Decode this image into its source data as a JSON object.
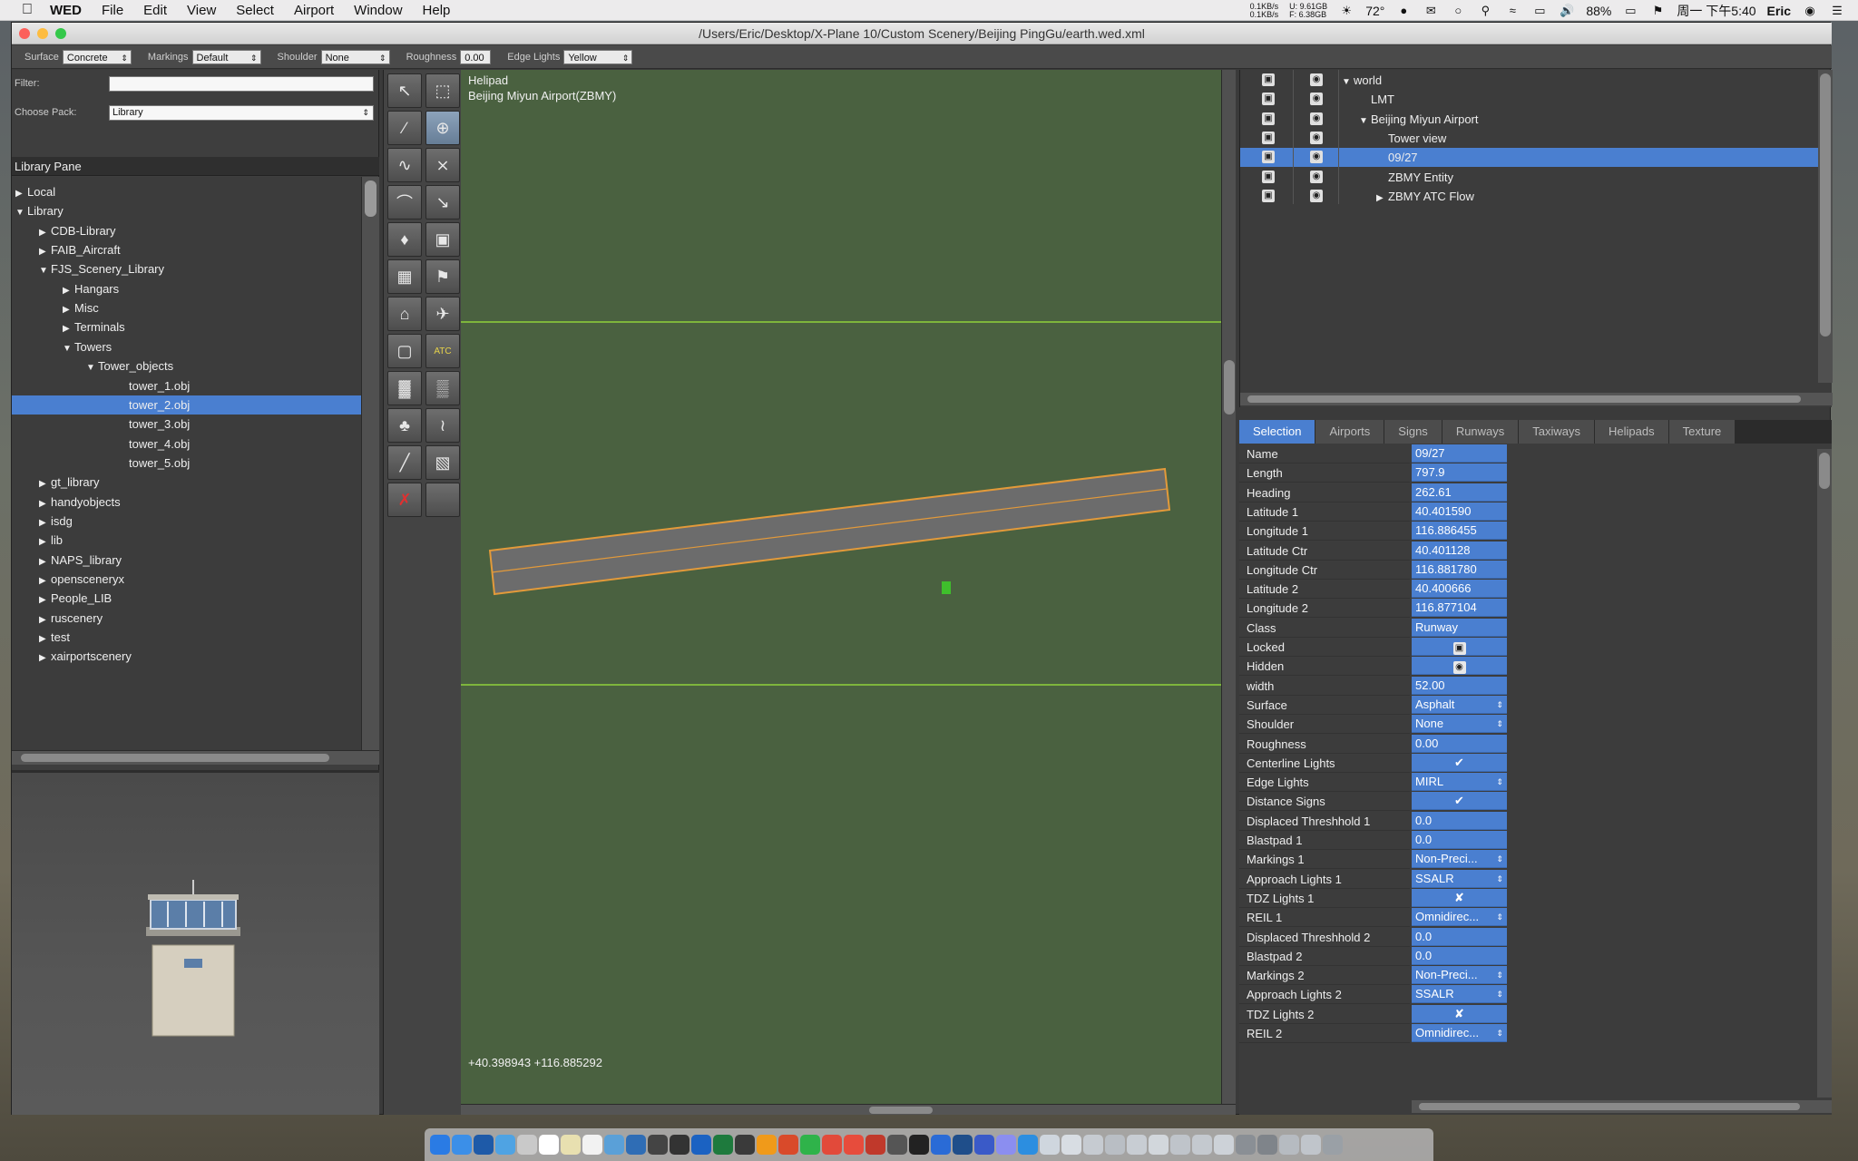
{
  "menubar": {
    "app_name": "WED",
    "items": [
      "File",
      "Edit",
      "View",
      "Select",
      "Airport",
      "Window",
      "Help"
    ],
    "net_up": "0.1KB/s",
    "net_down": "0.1KB/s",
    "mem_u": "U: 9.61GB",
    "mem_f": "F: 6.38GB",
    "temperature": "72°",
    "battery": "88%",
    "clock": "周一 下午5:40",
    "user": "Eric"
  },
  "window": {
    "title": "/Users/Eric/Desktop/X-Plane 10/Custom Scenery/Beijing PingGu/earth.wed.xml"
  },
  "toolbar": {
    "surface_label": "Surface",
    "surface_value": "Concrete",
    "markings_label": "Markings",
    "markings_value": "Default",
    "shoulder_label": "Shoulder",
    "shoulder_value": "None",
    "roughness_label": "Roughness",
    "roughness_value": "0.00",
    "edge_lights_label": "Edge Lights",
    "edge_lights_value": "Yellow"
  },
  "library": {
    "filter_label": "Filter:",
    "filter_value": "",
    "pack_label": "Choose Pack:",
    "pack_value": "Library",
    "pane_title": "Library Pane",
    "tree": [
      {
        "label": "Local",
        "expanded": false,
        "depth": 0,
        "has_children": true
      },
      {
        "label": "Library",
        "expanded": true,
        "depth": 0,
        "has_children": true
      },
      {
        "label": "CDB-Library",
        "expanded": false,
        "depth": 1,
        "has_children": true
      },
      {
        "label": "FAIB_Aircraft",
        "expanded": false,
        "depth": 1,
        "has_children": true
      },
      {
        "label": "FJS_Scenery_Library",
        "expanded": true,
        "depth": 1,
        "has_children": true
      },
      {
        "label": "Hangars",
        "expanded": false,
        "depth": 2,
        "has_children": true
      },
      {
        "label": "Misc",
        "expanded": false,
        "depth": 2,
        "has_children": true
      },
      {
        "label": "Terminals",
        "expanded": false,
        "depth": 2,
        "has_children": true
      },
      {
        "label": "Towers",
        "expanded": true,
        "depth": 2,
        "has_children": true
      },
      {
        "label": "Tower_objects",
        "expanded": true,
        "depth": 3,
        "has_children": true
      },
      {
        "label": "tower_1.obj",
        "depth": 4,
        "has_children": false
      },
      {
        "label": "tower_2.obj",
        "depth": 4,
        "has_children": false,
        "selected": true
      },
      {
        "label": "tower_3.obj",
        "depth": 4,
        "has_children": false
      },
      {
        "label": "tower_4.obj",
        "depth": 4,
        "has_children": false
      },
      {
        "label": "tower_5.obj",
        "depth": 4,
        "has_children": false
      },
      {
        "label": "gt_library",
        "expanded": false,
        "depth": 1,
        "has_children": true
      },
      {
        "label": "handyobjects",
        "expanded": false,
        "depth": 1,
        "has_children": true
      },
      {
        "label": "isdg",
        "expanded": false,
        "depth": 1,
        "has_children": true
      },
      {
        "label": "lib",
        "expanded": false,
        "depth": 1,
        "has_children": true
      },
      {
        "label": "NAPS_library",
        "expanded": false,
        "depth": 1,
        "has_children": true
      },
      {
        "label": "opensceneryx",
        "expanded": false,
        "depth": 1,
        "has_children": true
      },
      {
        "label": "People_LIB",
        "expanded": false,
        "depth": 1,
        "has_children": true
      },
      {
        "label": "ruscenery",
        "expanded": false,
        "depth": 1,
        "has_children": true
      },
      {
        "label": "test",
        "expanded": false,
        "depth": 1,
        "has_children": true
      },
      {
        "label": "xairportscenery",
        "expanded": false,
        "depth": 1,
        "has_children": true
      }
    ]
  },
  "tools": [
    "select-arrow",
    "marquee",
    "runway",
    "helipad",
    "sealane",
    "taxiway",
    "taxi-route",
    "taxiway-line",
    "light-fixture",
    "sign",
    "object",
    "windsock",
    "tower-viewpoint",
    "ramp-start",
    "boundary",
    "atc-flow",
    "facade",
    "forest",
    "tree",
    "string",
    "line",
    "polygon",
    "exclusion",
    "blank"
  ],
  "map": {
    "tool_name": "Helipad",
    "airport_name": "Beijing Miyun Airport(ZBMY)",
    "cursor_coords": "+40.398943 +116.885292"
  },
  "hierarchy": {
    "rows": [
      {
        "label": "world",
        "depth": 0,
        "expanded": true,
        "has_children": true
      },
      {
        "label": "LMT",
        "depth": 1,
        "has_children": false
      },
      {
        "label": "Beijing Miyun Airport",
        "depth": 1,
        "expanded": true,
        "has_children": true
      },
      {
        "label": "Tower view",
        "depth": 2,
        "has_children": false
      },
      {
        "label": "09/27",
        "depth": 2,
        "has_children": false,
        "selected": true
      },
      {
        "label": "ZBMY Entity",
        "depth": 2,
        "has_children": false
      },
      {
        "label": "ZBMY ATC Flow",
        "depth": 2,
        "expanded": false,
        "has_children": true
      }
    ]
  },
  "tabs": [
    "Selection",
    "Airports",
    "Signs",
    "Runways",
    "Taxiways",
    "Helipads",
    "Texture"
  ],
  "properties": [
    {
      "name": "Name",
      "value": "09/27"
    },
    {
      "name": "Length",
      "value": "797.9"
    },
    {
      "name": "Heading",
      "value": "262.61"
    },
    {
      "name": "Latitude 1",
      "value": " 40.401590"
    },
    {
      "name": "Longitude 1",
      "value": " 116.886455"
    },
    {
      "name": "Latitude Ctr",
      "value": " 40.401128"
    },
    {
      "name": "Longitude Ctr",
      "value": " 116.881780"
    },
    {
      "name": "Latitude 2",
      "value": " 40.400666"
    },
    {
      "name": "Longitude 2",
      "value": " 116.877104"
    },
    {
      "name": "Class",
      "value": "Runway"
    },
    {
      "name": "Locked",
      "value": "",
      "kind": "lock"
    },
    {
      "name": "Hidden",
      "value": "",
      "kind": "eye"
    },
    {
      "name": "width",
      "value": " 52.00"
    },
    {
      "name": "Surface",
      "value": "Asphalt",
      "kind": "popup"
    },
    {
      "name": "Shoulder",
      "value": "None",
      "kind": "popup"
    },
    {
      "name": "Roughness",
      "value": " 0.00"
    },
    {
      "name": "Centerline Lights",
      "value": "✔",
      "kind": "check"
    },
    {
      "name": "Edge Lights",
      "value": "MIRL",
      "kind": "popup"
    },
    {
      "name": "Distance Signs",
      "value": "✔",
      "kind": "check"
    },
    {
      "name": "Displaced Threshhold 1",
      "value": "   0.0"
    },
    {
      "name": "Blastpad 1",
      "value": "   0.0"
    },
    {
      "name": "Markings 1",
      "value": "Non-Preci...",
      "kind": "popup"
    },
    {
      "name": "Approach Lights 1",
      "value": "SSALR",
      "kind": "popup"
    },
    {
      "name": "TDZ Lights 1",
      "value": "✘",
      "kind": "check"
    },
    {
      "name": "REIL 1",
      "value": "Omnidirec...",
      "kind": "popup"
    },
    {
      "name": "Displaced Threshhold 2",
      "value": "   0.0"
    },
    {
      "name": "Blastpad 2",
      "value": "   0.0"
    },
    {
      "name": "Markings 2",
      "value": "Non-Preci...",
      "kind": "popup"
    },
    {
      "name": "Approach Lights 2",
      "value": "SSALR",
      "kind": "popup"
    },
    {
      "name": "TDZ Lights 2",
      "value": "✘",
      "kind": "check"
    },
    {
      "name": "REIL 2",
      "value": "Omnidirec...",
      "kind": "popup"
    }
  ],
  "colors": {
    "selection": "#4a7fd0",
    "map_ground": "#4a6140",
    "runway_edge": "#e39a3a",
    "boundary_line": "#8fd13a"
  }
}
